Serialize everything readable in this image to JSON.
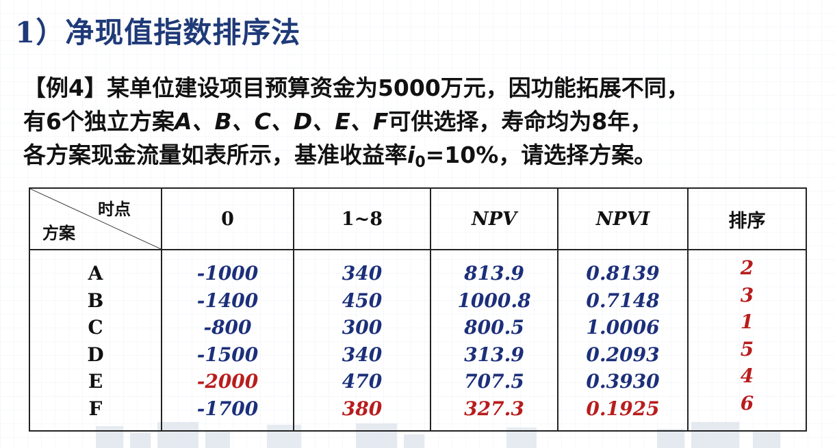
{
  "title": "1）净现值指数排序法",
  "problem": {
    "line1": "【例4】某单位建设项目预算资金为5000万元，因功能拓展不同，",
    "line2_pre": "有6个独立方案",
    "line2_vars": "A、B、C、D、E、F",
    "line2_post": "可供选择，寿命均为8年，",
    "line3_pre": "各方案现金流量如表所示，基准收益率",
    "line3_var": "i",
    "line3_sub": "0",
    "line3_post": "=10%，请选择方案。"
  },
  "table": {
    "corner_top": "时点",
    "corner_bottom": "方案",
    "headers": [
      "0",
      "1~8",
      "NPV",
      "NPVI",
      "排序"
    ],
    "rows": [
      {
        "plan": "A",
        "t0": "-1000",
        "t18": "340",
        "npv": "813.9",
        "npvi": "0.8139",
        "rank": "2"
      },
      {
        "plan": "B",
        "t0": "-1400",
        "t18": "450",
        "npv": "1000.8",
        "npvi": "0.7148",
        "rank": "3"
      },
      {
        "plan": "C",
        "t0": "-800",
        "t18": "300",
        "npv": "800.5",
        "npvi": "1.0006",
        "rank": "1"
      },
      {
        "plan": "D",
        "t0": "-1500",
        "t18": "340",
        "npv": "313.9",
        "npvi": "0.2093",
        "rank": "5"
      },
      {
        "plan": "E",
        "t0": "-2000",
        "t18": "470",
        "npv": "707.5",
        "npvi": "0.3930",
        "rank": "4"
      },
      {
        "plan": "F",
        "t0": "-1700",
        "t18": "380",
        "npv": "327.3",
        "npvi": "0.1925",
        "rank": "6"
      }
    ]
  },
  "colors": {
    "title": "#1f3a78",
    "blue_value": "#1c2f7a",
    "red_value": "#b81d1d"
  }
}
